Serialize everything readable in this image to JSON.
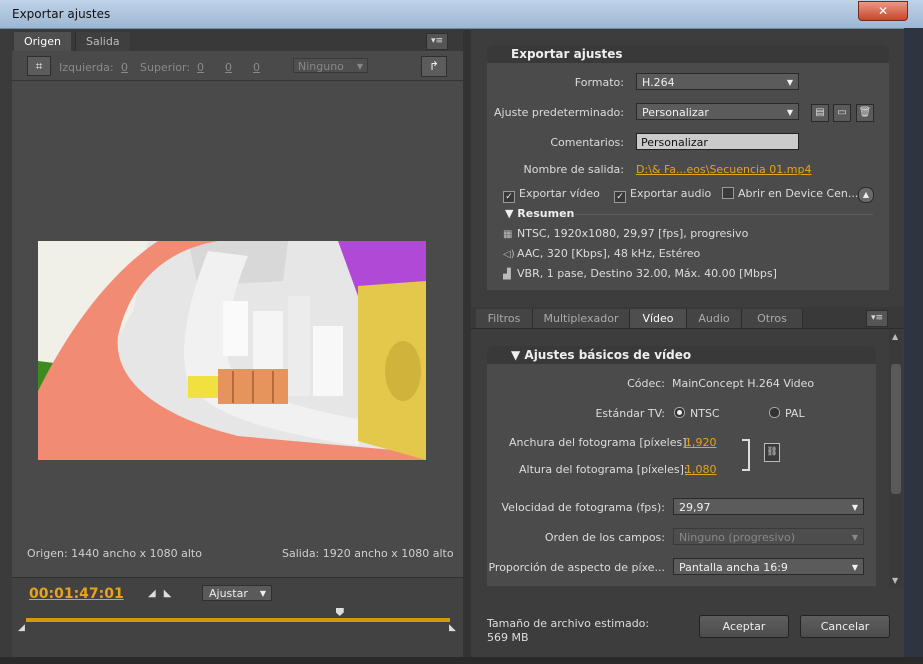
{
  "window": {
    "title": "Exportar ajustes",
    "close_glyph": "✕"
  },
  "left": {
    "tabs": [
      "Origen",
      "Salida"
    ],
    "toolbar": {
      "left_label": "Izquierda:",
      "left_val": "0",
      "top_label": "Superior:",
      "top_val": "0",
      "v3": "0",
      "v4": "0",
      "aspect_dd": "Ninguno"
    },
    "origin_info": "Origen: 1440 ancho x 1080 alto",
    "output_info": "Salida: 1920 ancho x 1080 alto",
    "timecode": "00:01:47:01",
    "fit_dd": "Ajustar",
    "playhead_fraction": 0.74
  },
  "export": {
    "head": "Exportar ajustes",
    "format_label": "Formato:",
    "format_value": "H.264",
    "preset_label": "Ajuste predeterminado:",
    "preset_value": "Personalizar",
    "comments_label": "Comentarios:",
    "comments_value": "Personalizar",
    "output_label": "Nombre de salida:",
    "output_value": "D:\\& Fa...eos\\Secuencia 01.mp4",
    "export_video": "Exportar vídeo",
    "export_audio": "Exportar audio",
    "device_central": "Abrir en Device Cen...",
    "summary_head": "Resumen",
    "summary": [
      "NTSC, 1920x1080, 29,97 [fps], progresivo",
      "AAC, 320 [Kbps], 48 kHz, Estéreo",
      "VBR, 1 pase, Destino 32.00, Máx. 40.00 [Mbps]"
    ]
  },
  "tabs_r": [
    "Filtros",
    "Multiplexador",
    "Vídeo",
    "Audio",
    "Otros"
  ],
  "video": {
    "head": "Ajustes básicos de vídeo",
    "codec_label": "Códec:",
    "codec_value": "MainConcept H.264 Video",
    "tv_label": "Estándar TV:",
    "ntsc": "NTSC",
    "pal": "PAL",
    "width_label": "Anchura del fotograma [píxeles]:",
    "width_value": "1,920",
    "height_label": "Altura del fotograma [píxeles]:",
    "height_value": "1,080",
    "fps_label": "Velocidad de fotograma (fps):",
    "fps_value": "29,97",
    "field_label": "Orden de los campos:",
    "field_value": "Ninguno (progresivo)",
    "pixel_label": "Proporción de aspecto de píxe...",
    "pixel_value": "Pantalla ancha 16:9"
  },
  "footer": {
    "size_label": "Tamaño de archivo estimado:",
    "size_value": "569 MB",
    "accept": "Aceptar",
    "cancel": "Cancelar"
  }
}
